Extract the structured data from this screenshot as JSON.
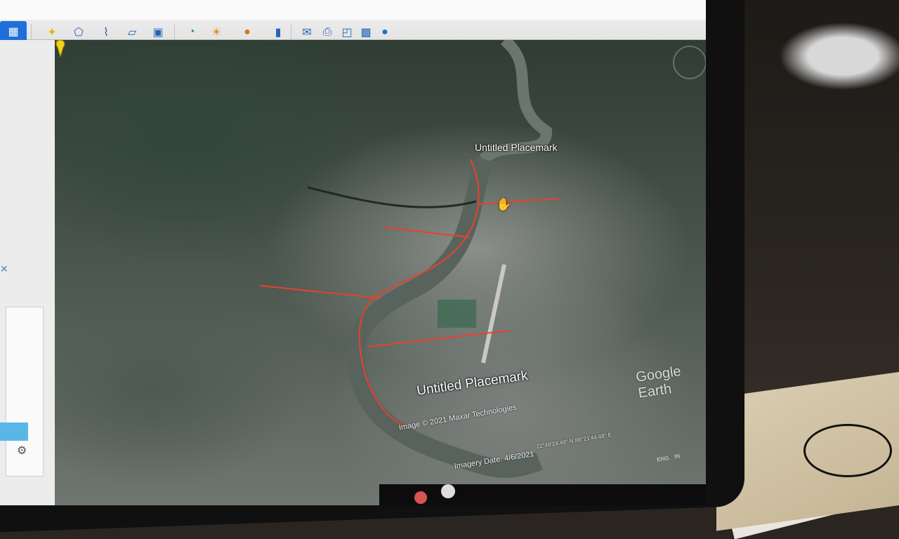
{
  "toolbar": {
    "buttons": [
      {
        "name": "sidebar-toggle-icon",
        "glyph": "▦"
      },
      {
        "name": "add-placemark-icon",
        "glyph": "✦"
      },
      {
        "name": "add-polygon-icon",
        "glyph": "⬠"
      },
      {
        "name": "add-path-icon",
        "glyph": "⌇"
      },
      {
        "name": "add-overlay-icon",
        "glyph": "▱"
      },
      {
        "name": "record-tour-icon",
        "glyph": "▣"
      },
      {
        "name": "historical-imagery-icon",
        "glyph": "◔"
      },
      {
        "name": "sunlight-icon",
        "glyph": "☀"
      },
      {
        "name": "planets-icon",
        "glyph": "●"
      },
      {
        "name": "ruler-icon",
        "glyph": "▮"
      },
      {
        "name": "email-icon",
        "glyph": "✉"
      },
      {
        "name": "print-icon",
        "glyph": "⎙"
      },
      {
        "name": "save-image-icon",
        "glyph": "◰"
      },
      {
        "name": "view-in-maps-icon",
        "glyph": "▩"
      },
      {
        "name": "globe-icon",
        "glyph": "●"
      }
    ]
  },
  "map": {
    "placemarks": [
      {
        "label": "Untitled Placemark"
      },
      {
        "label": "Untitled Placemark"
      }
    ],
    "watermark": "Google Earth",
    "copyright": "Image © 2021 Maxar Technologies",
    "imagery_date": "Imagery Date: 4/6/2021",
    "coordinates": "22°48'24.49\" N   88°21'44.48\" E",
    "route_color": "#e8412f"
  },
  "taskbar": {
    "language": "ENG",
    "region": "IN"
  }
}
